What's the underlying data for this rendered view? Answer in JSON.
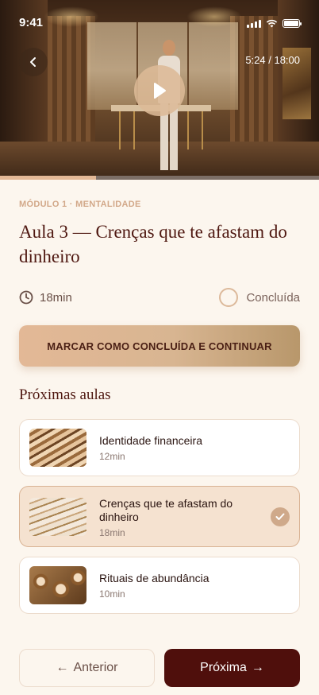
{
  "status_bar": {
    "time": "9:41"
  },
  "video": {
    "time_readout": "5:24 / 18:00",
    "progress": 0.3
  },
  "lesson": {
    "module_label": "MÓDULO 1 · MENTALIDADE",
    "title": "Aula 3 — Crenças que te afastam do dinheiro",
    "duration": "18min",
    "complete_label": "Concluída",
    "cta_label": "MARCAR COMO CONCLUÍDA E CONTINUAR"
  },
  "upcoming": {
    "section_title": "Próximas aulas",
    "items": [
      {
        "title": "Identidade financeira",
        "duration": "12min",
        "active": false,
        "thumb": "golden-waves"
      },
      {
        "title": "Crenças que te afastam do dinheiro",
        "duration": "18min",
        "active": true,
        "thumb": "cream-waves"
      },
      {
        "title": "Rituais de abundância",
        "duration": "10min",
        "active": false,
        "thumb": "golden-swirls"
      }
    ]
  },
  "nav": {
    "prev_label": "Anterior",
    "next_label": "Próxima",
    "prev_arrow": "←",
    "next_arrow": "→"
  },
  "colors": {
    "background": "#fcf6ee",
    "accent": "#e3b896",
    "primary_dark": "#4f0f0c",
    "title_text": "#4f1811",
    "module_label": "#d2a889"
  },
  "icons": {
    "back": "chevron-left-icon",
    "play": "play-icon",
    "clock": "clock-icon",
    "check": "check-icon"
  }
}
